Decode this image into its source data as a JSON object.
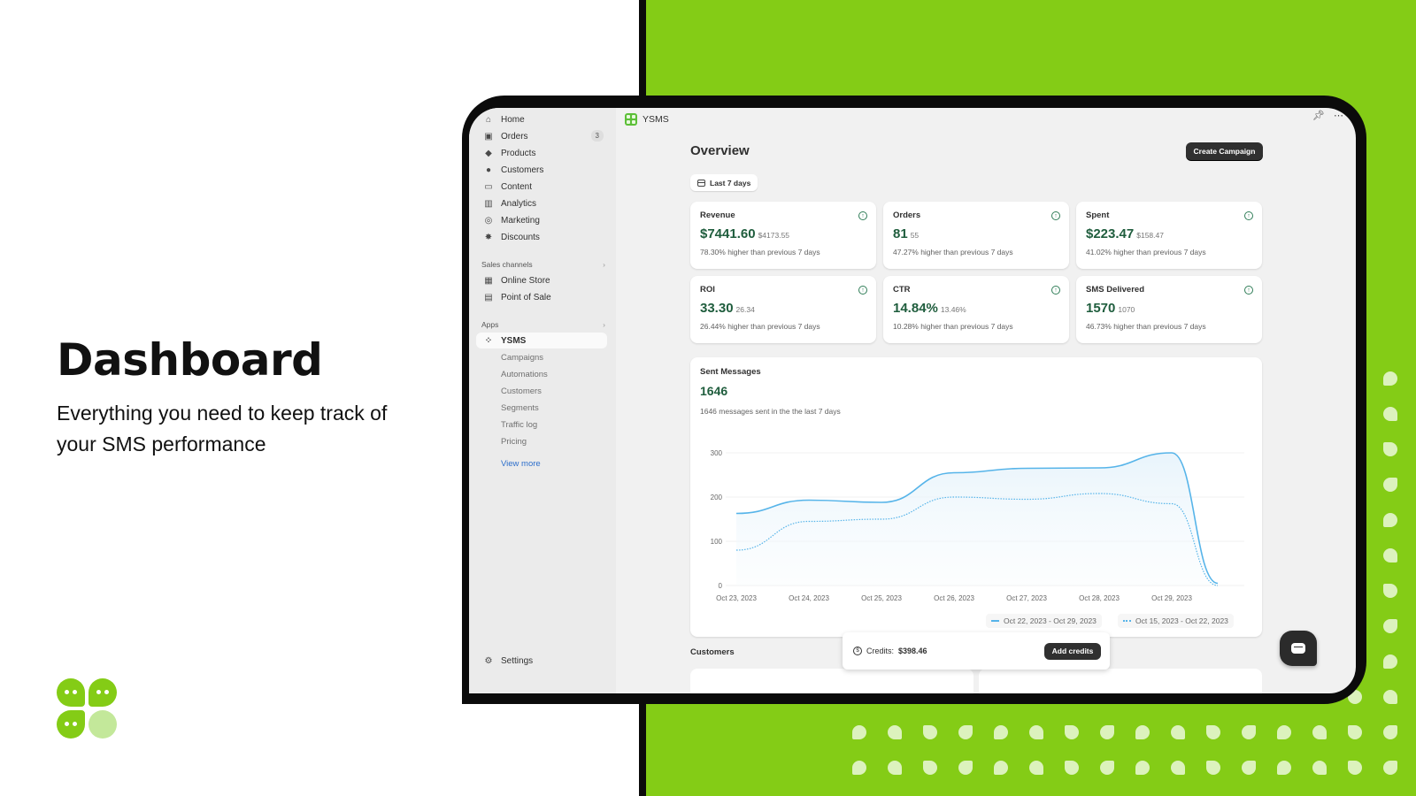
{
  "hero": {
    "title": "Dashboard",
    "subtitle": "Everything you need to keep track of your SMS performance"
  },
  "colors": {
    "brand_green": "#84cc16",
    "value_green": "#1f5d3d",
    "chart_line": "#56b4e9"
  },
  "sidebar": {
    "items": [
      {
        "label": "Home",
        "icon": "home-icon"
      },
      {
        "label": "Orders",
        "icon": "inbox-icon",
        "badge": "3"
      },
      {
        "label": "Products",
        "icon": "tag-icon"
      },
      {
        "label": "Customers",
        "icon": "person-icon"
      },
      {
        "label": "Content",
        "icon": "image-icon"
      },
      {
        "label": "Analytics",
        "icon": "bar-chart-icon"
      },
      {
        "label": "Marketing",
        "icon": "target-icon"
      },
      {
        "label": "Discounts",
        "icon": "discount-icon"
      }
    ],
    "sales_channels_label": "Sales channels",
    "sales_channels": [
      {
        "label": "Online Store",
        "icon": "store-icon"
      },
      {
        "label": "Point of Sale",
        "icon": "pos-icon"
      }
    ],
    "apps_label": "Apps",
    "app_active": "YSMS",
    "app_subitems": [
      "Campaigns",
      "Automations",
      "Customers",
      "Segments",
      "Traffic log",
      "Pricing"
    ],
    "view_more": "View more",
    "settings": "Settings"
  },
  "header": {
    "app_name": "YSMS"
  },
  "main": {
    "title": "Overview",
    "create_button": "Create Campaign",
    "date_filter": "Last 7 days",
    "kpis": [
      {
        "label": "Revenue",
        "value": "$7441.60",
        "previous": "$4173.55",
        "note": "78.30% higher than previous 7 days"
      },
      {
        "label": "Orders",
        "value": "81",
        "previous": "55",
        "note": "47.27% higher than previous 7 days"
      },
      {
        "label": "Spent",
        "value": "$223.47",
        "previous": "$158.47",
        "note": "41.02% higher than previous 7 days"
      },
      {
        "label": "ROI",
        "value": "33.30",
        "previous": "26.34",
        "note": "26.44% higher than previous 7 days"
      },
      {
        "label": "CTR",
        "value": "14.84%",
        "previous": "13.46%",
        "note": "10.28% higher than previous 7 days"
      },
      {
        "label": "SMS Delivered",
        "value": "1570",
        "previous": "1070",
        "note": "46.73% higher than previous 7 days"
      }
    ],
    "sent_messages": {
      "label": "Sent Messages",
      "value": "1646",
      "subtitle": "1646 messages sent in the the last 7 days"
    },
    "customers_label": "Customers"
  },
  "credits": {
    "label": "Credits:",
    "amount": "$398.46",
    "button": "Add credits"
  },
  "chart_data": {
    "type": "line",
    "title": "Sent Messages",
    "x": [
      "Oct 23, 2023",
      "Oct 24, 2023",
      "Oct 25, 2023",
      "Oct 26, 2023",
      "Oct 27, 2023",
      "Oct 28, 2023",
      "Oct 29, 2023",
      ""
    ],
    "xticks": [
      "Oct 23, 2023",
      "Oct 24, 2023",
      "Oct 25, 2023",
      "Oct 26, 2023",
      "Oct 27, 2023",
      "Oct 28, 2023",
      "Oct 29, 2023"
    ],
    "yticks": [
      0,
      100,
      200,
      300
    ],
    "ylim": [
      0,
      310
    ],
    "grid": true,
    "legend_position": "bottom-right",
    "series": [
      {
        "name": "Oct 22, 2023 - Oct 29, 2023",
        "style": "solid",
        "values": [
          163,
          193,
          188,
          255,
          265,
          266,
          300,
          5
        ]
      },
      {
        "name": "Oct 15, 2023 - Oct 22, 2023",
        "style": "dotted",
        "values": [
          80,
          145,
          150,
          200,
          195,
          208,
          185,
          0
        ]
      }
    ]
  }
}
